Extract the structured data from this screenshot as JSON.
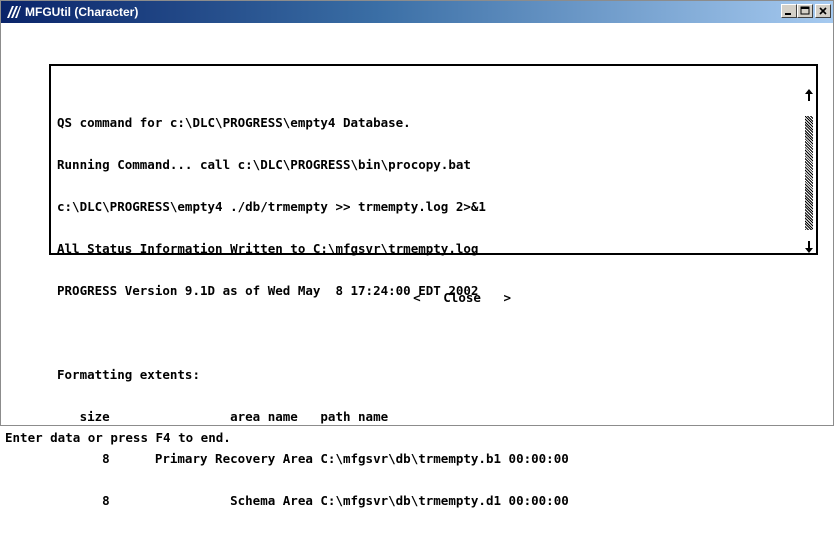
{
  "window": {
    "title": "MFGUtil (Character)",
    "controls": [
      "minimize-icon",
      "maximize-icon",
      "close-icon"
    ]
  },
  "output": {
    "lines": [
      "QS command for c:\\DLC\\PROGRESS\\empty4 Database.",
      "Running Command... call c:\\DLC\\PROGRESS\\bin\\procopy.bat",
      "c:\\DLC\\PROGRESS\\empty4 ./db/trmempty >> trmempty.log 2>&1",
      "All Status Information Written to C:\\mfgsvr\\trmempty.log",
      "PROGRESS Version 9.1D as of Wed May  8 17:24:00 EDT 2002",
      "",
      "Formatting extents:",
      "   size                area name   path name",
      "      8      Primary Recovery Area C:\\mfgsvr\\db\\trmempty.b1 00:00:00",
      "      8                Schema Area C:\\mfgsvr\\db\\trmempty.d1 00:00:00"
    ]
  },
  "buttons": {
    "prev_label": "<",
    "close_label": "Close",
    "next_label": ">"
  },
  "status_bar": {
    "text": "Enter data or press F4 to end."
  },
  "colors": {
    "titlebar_start": "#0a246a",
    "titlebar_end": "#a6caf0",
    "background": "#ffffff",
    "text": "#000000"
  }
}
